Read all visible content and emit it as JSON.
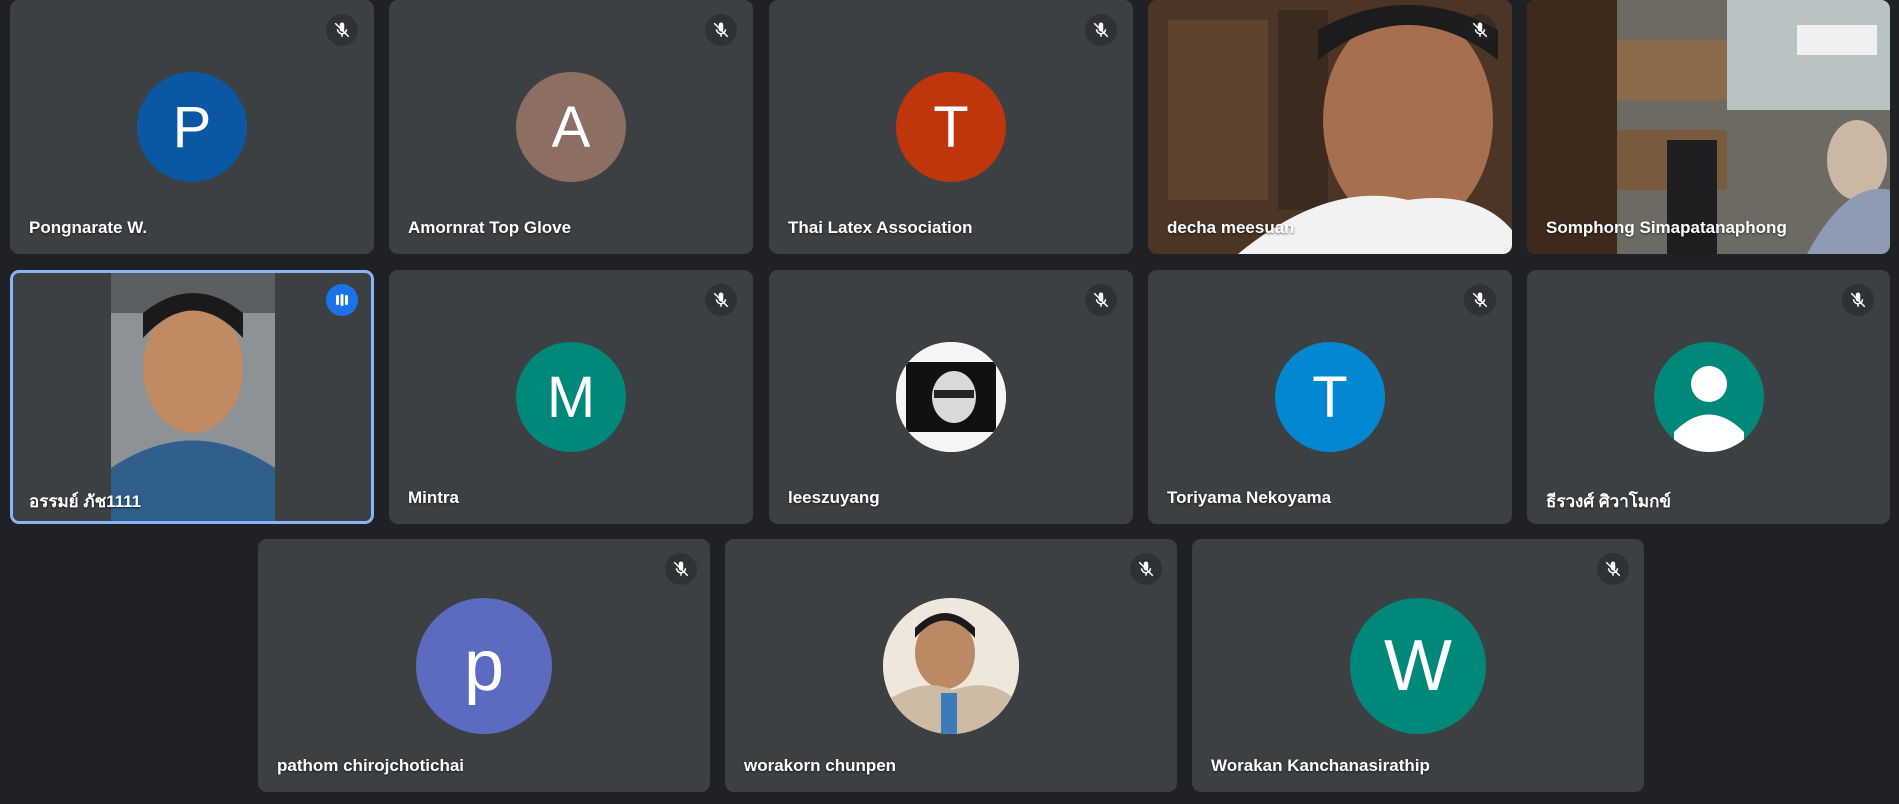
{
  "participants": [
    {
      "name": "Pongnarate W.",
      "initial": "P",
      "avatar_color": "#0b57a4",
      "mic": "muted"
    },
    {
      "name": "Amornrat Top Glove",
      "initial": "A",
      "avatar_color": "#8d6e63",
      "mic": "muted"
    },
    {
      "name": "Thai Latex Association",
      "initial": "T",
      "avatar_color": "#c0360c",
      "mic": "muted"
    },
    {
      "name": "decha meesuan",
      "mic": "muted",
      "video": "camera-feed"
    },
    {
      "name": "Somphong Simapatanaphong",
      "mic": "muted",
      "video": "camera-feed"
    },
    {
      "name": "อรรมย์ ภัช1111",
      "mic": "speaking",
      "video": "camera-feed"
    },
    {
      "name": "Mintra",
      "initial": "M",
      "avatar_color": "#00897b",
      "mic": "muted"
    },
    {
      "name": "leeszuyang",
      "avatar": "profile-photo",
      "mic": "muted"
    },
    {
      "name": "Toriyama Nekoyama",
      "initial": "T",
      "avatar_color": "#0288d1",
      "mic": "muted"
    },
    {
      "name": "ธีรวงศ์ ศิวาโมกข์",
      "avatar": "default-person",
      "avatar_color": "#00897b",
      "mic": "muted"
    },
    {
      "name": "pathom chirojchotichai",
      "initial": "p",
      "avatar_color": "#5c6bc0",
      "mic": "muted"
    },
    {
      "name": "worakorn chunpen",
      "avatar": "profile-photo",
      "mic": "muted"
    },
    {
      "name": "Worakan Kanchanasirathip",
      "initial": "W",
      "avatar_color": "#00897b",
      "mic": "muted"
    }
  ]
}
